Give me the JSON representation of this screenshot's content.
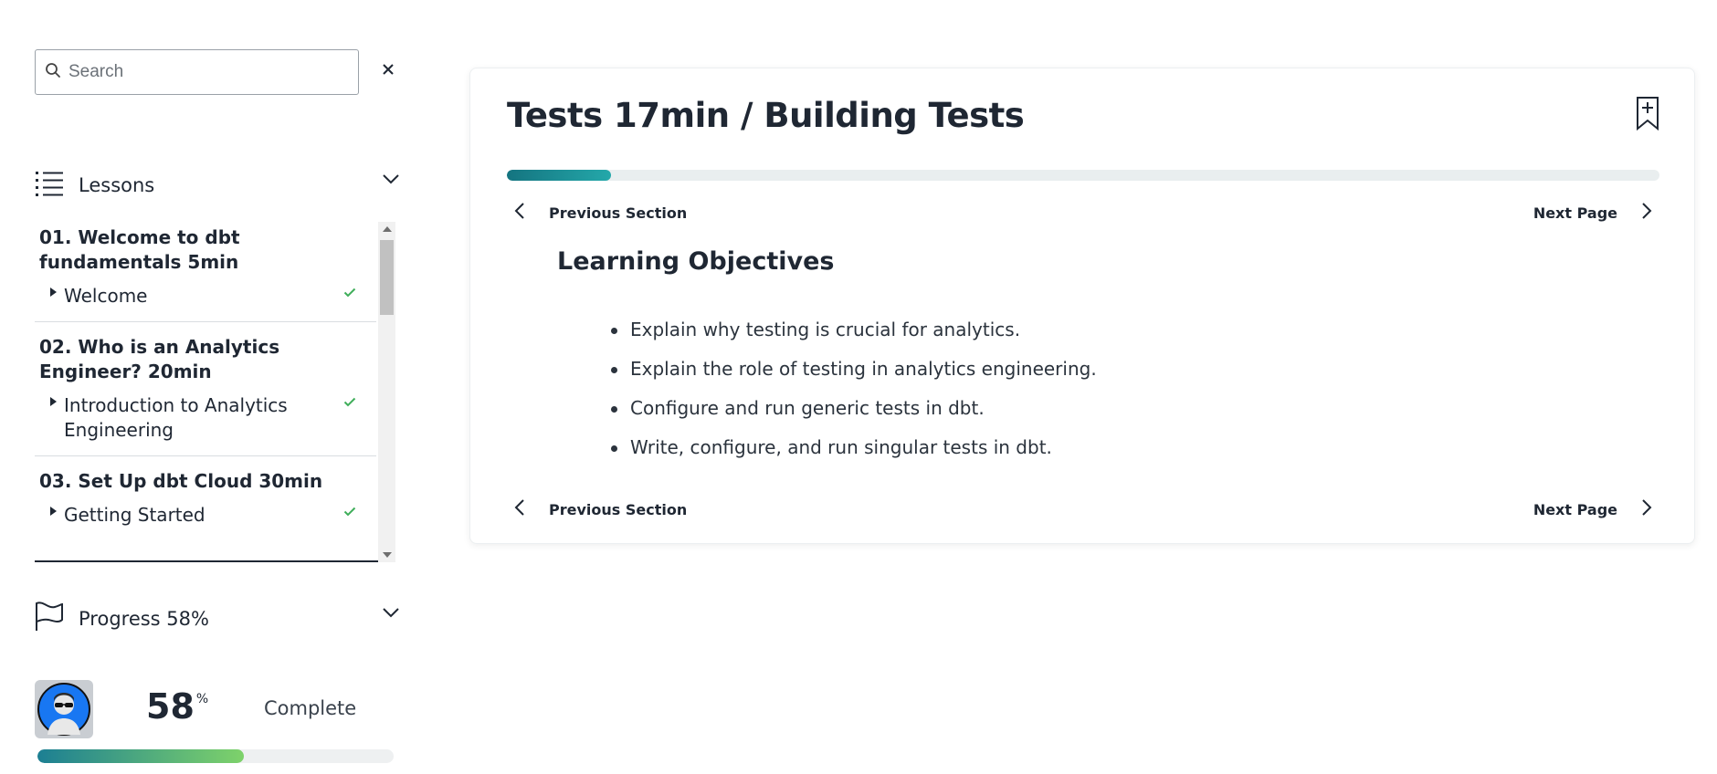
{
  "sidebar": {
    "search": {
      "placeholder": "Search",
      "value": ""
    },
    "lessons_label": "Lessons",
    "modules": [
      {
        "title": "01. Welcome to dbt fundamentals 5min",
        "items": [
          {
            "label": "Welcome",
            "completed": true
          }
        ]
      },
      {
        "title": "02. Who is an Analytics Engineer? 20min",
        "items": [
          {
            "label": "Introduction to Analytics Engineering",
            "completed": true
          }
        ]
      },
      {
        "title": "03. Set Up dbt Cloud 30min",
        "items": [
          {
            "label": "Getting Started",
            "completed": true
          }
        ]
      }
    ],
    "progress_label": "Progress 58%",
    "progress": {
      "value": "58",
      "unit": "%",
      "complete_label": "Complete",
      "fraction": 0.58
    }
  },
  "main": {
    "title": "Tests 17min / Building Tests",
    "progress_fraction": 0.09,
    "nav": {
      "previous_label": "Previous Section",
      "next_label": "Next Page"
    },
    "objectives_title": "Learning Objectives",
    "objectives": [
      "Explain why testing is crucial for analytics.",
      "Explain the role of testing in analytics engineering.",
      "Configure and run generic tests in dbt.",
      "Write, configure, and run singular tests in dbt."
    ]
  },
  "colors": {
    "text": "#1f2733",
    "check": "#3fae5a",
    "main_progress": "#147480",
    "sidebar_progress_start": "#1c7f93",
    "sidebar_progress_end": "#7ed26a",
    "avatar_ring": "#1877f2"
  },
  "icons": {
    "search": "search-icon",
    "clear": "close-icon",
    "lessons": "list-icon",
    "progress": "flag-icon",
    "chevron": "chevron-down-icon",
    "check": "check-icon",
    "bookmark": "bookmark-add-icon",
    "prev": "chevron-left-icon",
    "next": "chevron-right-icon"
  }
}
